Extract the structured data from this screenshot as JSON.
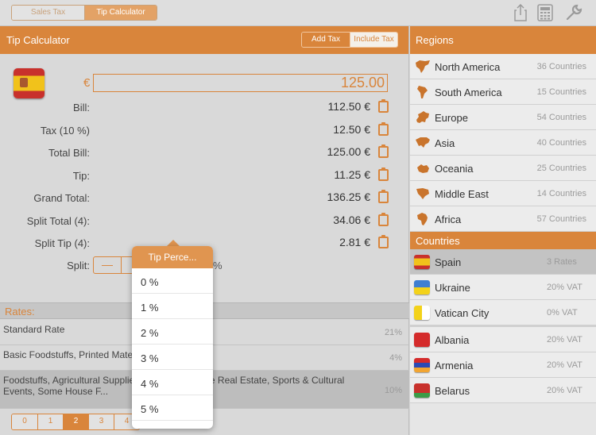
{
  "top_tabs": [
    {
      "label": "Sales Tax",
      "active": false
    },
    {
      "label": "Tip Calculator",
      "active": true
    }
  ],
  "toolbar_icons": [
    "share-icon",
    "calculator-icon",
    "wrench-icon"
  ],
  "calc": {
    "title": "Tip Calculator",
    "tax_mode": [
      {
        "label": "Add Tax",
        "active": false
      },
      {
        "label": "Include Tax",
        "active": true
      }
    ],
    "currency": "€",
    "amount": "125.00",
    "lines": [
      {
        "label": "Bill:",
        "value": "112.50 €"
      },
      {
        "label": "Tax (10 %)",
        "value": "12.50 €"
      },
      {
        "label": "Total Bill:",
        "value": "125.00 €"
      },
      {
        "label": "Tip:",
        "value": "11.25 €"
      },
      {
        "label": "Grand Total:",
        "value": "136.25 €"
      },
      {
        "label": "Split Total (4):",
        "value": "34.06 €"
      },
      {
        "label": "Split Tip (4):",
        "value": "2.81 €"
      }
    ],
    "split_label": "Split:",
    "stepper": {
      "minus": "—",
      "plus": "+"
    },
    "split_pct": "%"
  },
  "rates": {
    "title": "Rates:",
    "items": [
      {
        "name": "Standard Rate",
        "pct": "21%",
        "selected": false
      },
      {
        "name": "Basic Foodstuffs, Printed Materials, ..., Housing",
        "pct": "4%",
        "selected": false
      },
      {
        "name": "Foodstuffs, Agricultural Supplies, ..., Some Private Real Estate, Sports & Cultural Events, Some House F...",
        "pct": "10%",
        "selected": true
      }
    ]
  },
  "pager": [
    {
      "label": "0",
      "active": false
    },
    {
      "label": "1",
      "active": false
    },
    {
      "label": "2",
      "active": true
    },
    {
      "label": "3",
      "active": false
    },
    {
      "label": "4",
      "active": false
    }
  ],
  "regions": {
    "title": "Regions",
    "items": [
      {
        "name": "North America",
        "count": "36 Countries",
        "icon": "north-america-map-icon"
      },
      {
        "name": "South America",
        "count": "15 Countries",
        "icon": "south-america-map-icon"
      },
      {
        "name": "Europe",
        "count": "54 Countries",
        "icon": "europe-map-icon"
      },
      {
        "name": "Asia",
        "count": "40 Countries",
        "icon": "asia-map-icon"
      },
      {
        "name": "Oceania",
        "count": "25 Countries",
        "icon": "oceania-map-icon"
      },
      {
        "name": "Middle East",
        "count": "14 Countries",
        "icon": "middle-east-map-icon"
      },
      {
        "name": "Africa",
        "count": "57 Countries",
        "icon": "africa-map-icon"
      }
    ]
  },
  "countries": {
    "title": "Countries",
    "items": [
      {
        "name": "Spain",
        "vat": "3 Rates",
        "selected": true,
        "flag": [
          "#c8312c",
          "#f1c21b",
          "#c8312c"
        ]
      },
      {
        "name": "Ukraine",
        "vat": "20% VAT",
        "selected": false,
        "flag": [
          "#3f7fd1",
          "#f3d21a"
        ]
      },
      {
        "name": "Vatican City",
        "vat": "0% VAT",
        "selected": false,
        "flag": [
          "#f3d21a",
          "#ffffff"
        ]
      },
      {
        "name": "Albania",
        "vat": "20% VAT",
        "selected": false,
        "flag": [
          "#d42b2b",
          "#d42b2b"
        ]
      },
      {
        "name": "Armenia",
        "vat": "20% VAT",
        "selected": false,
        "flag": [
          "#d42b2b",
          "#2a49b5",
          "#f2a531"
        ]
      },
      {
        "name": "Belarus",
        "vat": "20% VAT",
        "selected": false,
        "flag": [
          "#c8312c",
          "#3b9b47"
        ]
      }
    ]
  },
  "popover": {
    "title": "Tip Perce...",
    "options": [
      "0 %",
      "1 %",
      "2 %",
      "3 %",
      "4 %",
      "5 %"
    ]
  },
  "colors": {
    "accent": "#d9853b",
    "background": "#d9d9d9"
  }
}
